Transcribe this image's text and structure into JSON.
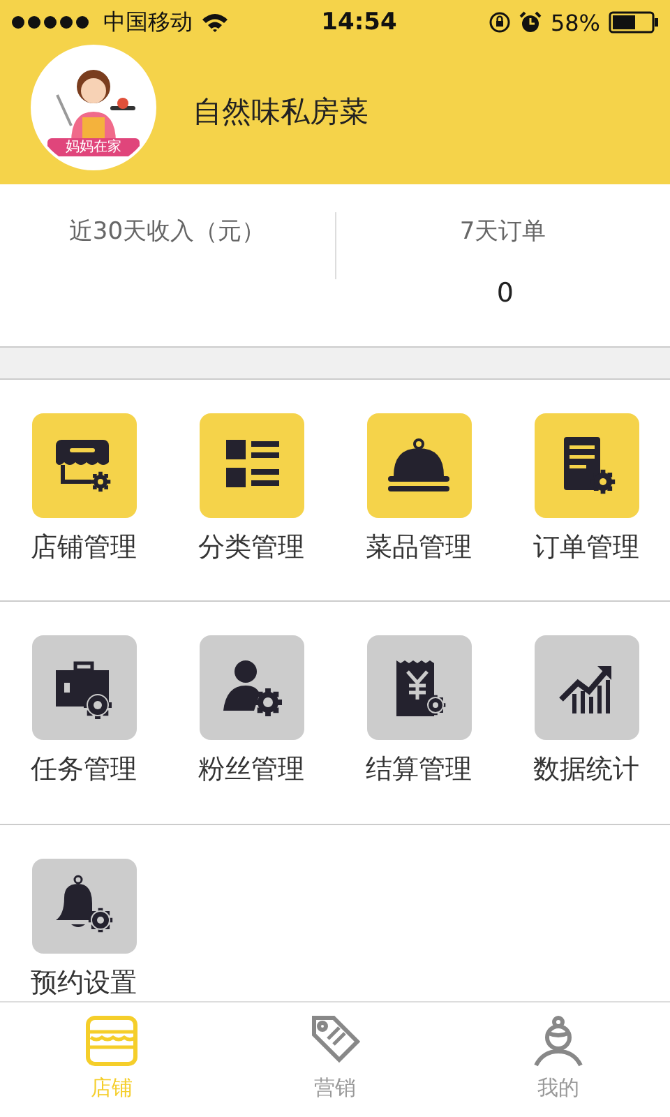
{
  "status_bar": {
    "carrier": "中国移动",
    "time": "14:54",
    "battery": "58%"
  },
  "header": {
    "avatar_badge": "妈妈在家",
    "shop_name": "自然味私房菜"
  },
  "stats": [
    {
      "label": "近30天收入（元）"
    },
    {
      "label": "7天订单",
      "value": "0"
    }
  ],
  "menu_rows": [
    [
      {
        "kind": "shop",
        "label": "店铺管理",
        "active": true
      },
      {
        "kind": "category",
        "label": "分类管理",
        "active": true
      },
      {
        "kind": "dish",
        "label": "菜品管理",
        "active": true
      },
      {
        "kind": "order",
        "label": "订单管理",
        "active": true
      }
    ],
    [
      {
        "kind": "task",
        "label": "任务管理",
        "active": false
      },
      {
        "kind": "fans",
        "label": "粉丝管理",
        "active": false
      },
      {
        "kind": "settlement",
        "label": "结算管理",
        "active": false
      },
      {
        "kind": "stats",
        "label": "数据统计",
        "active": false
      }
    ],
    [
      {
        "kind": "booking",
        "label": "预约设置",
        "active": false
      }
    ]
  ],
  "tab_bar": [
    {
      "kind": "store",
      "label": "店铺",
      "selected": true
    },
    {
      "kind": "tag",
      "label": "营销",
      "selected": false
    },
    {
      "kind": "person",
      "label": "我的",
      "selected": false
    }
  ]
}
